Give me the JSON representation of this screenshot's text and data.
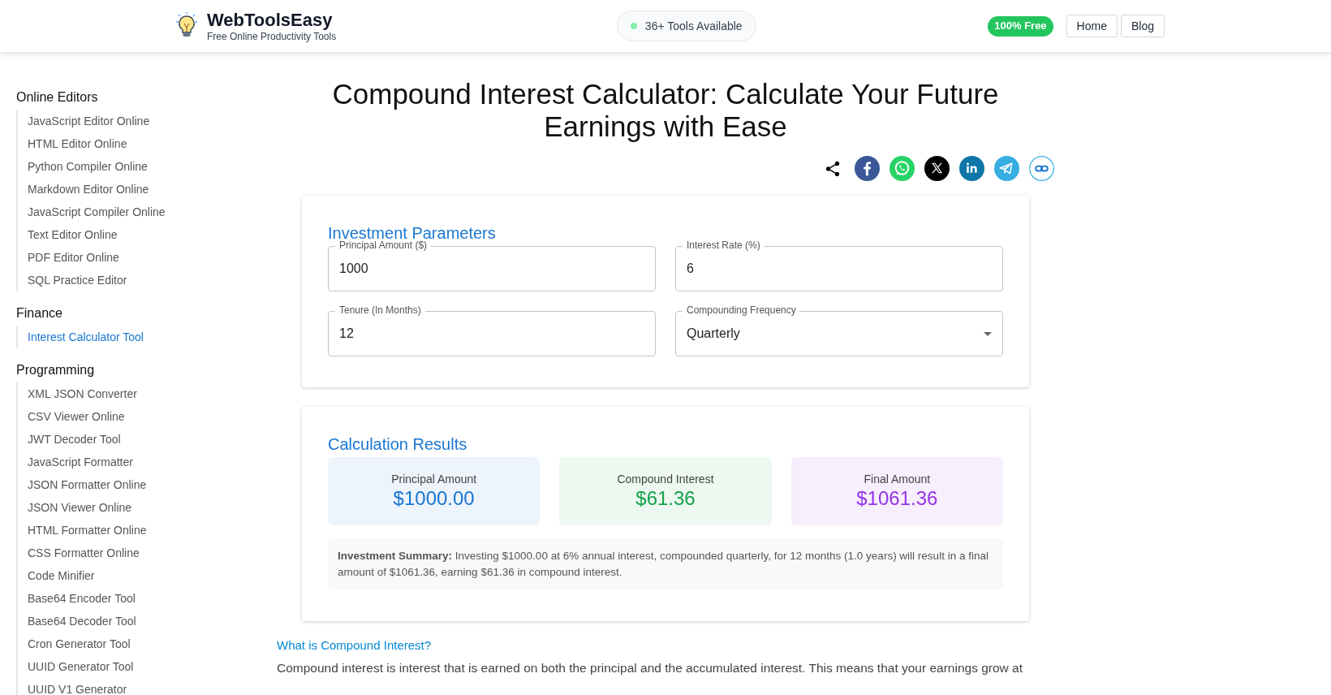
{
  "header": {
    "brand": "WebToolsEasy",
    "tagline": "Free Online Productivity Tools",
    "tools_pill": "36+ Tools Available",
    "free_badge": "100% Free",
    "nav": [
      "Home",
      "Blog"
    ]
  },
  "sidebar": [
    {
      "heading": "Online Editors",
      "items": [
        {
          "label": "JavaScript Editor Online",
          "selected": false
        },
        {
          "label": "HTML Editor Online",
          "selected": false
        },
        {
          "label": "Python Compiler Online",
          "selected": false
        },
        {
          "label": "Markdown Editor Online",
          "selected": false
        },
        {
          "label": "JavaScript Compiler Online",
          "selected": false
        },
        {
          "label": "Text Editor Online",
          "selected": false
        },
        {
          "label": "PDF Editor Online",
          "selected": false
        },
        {
          "label": "SQL Practice Editor",
          "selected": false
        }
      ]
    },
    {
      "heading": "Finance",
      "items": [
        {
          "label": "Interest Calculator Tool",
          "selected": true
        }
      ]
    },
    {
      "heading": "Programming",
      "items": [
        {
          "label": "XML JSON Converter",
          "selected": false
        },
        {
          "label": "CSV Viewer Online",
          "selected": false
        },
        {
          "label": "JWT Decoder Tool",
          "selected": false
        },
        {
          "label": "JavaScript Formatter",
          "selected": false
        },
        {
          "label": "JSON Formatter Online",
          "selected": false
        },
        {
          "label": "JSON Viewer Online",
          "selected": false
        },
        {
          "label": "HTML Formatter Online",
          "selected": false
        },
        {
          "label": "CSS Formatter Online",
          "selected": false
        },
        {
          "label": "Code Minifier",
          "selected": false
        },
        {
          "label": "Base64 Encoder Tool",
          "selected": false
        },
        {
          "label": "Base64 Decoder Tool",
          "selected": false
        },
        {
          "label": "Cron Generator Tool",
          "selected": false
        },
        {
          "label": "UUID Generator Tool",
          "selected": false
        },
        {
          "label": "UUID V1 Generator",
          "selected": false
        }
      ]
    }
  ],
  "title": "Compound Interest Calculator: Calculate Your Future Earnings with Ease",
  "parameters": {
    "heading": "Investment Parameters",
    "fields": [
      {
        "kind": "text",
        "label": "Principal Amount ($)",
        "value": "1000"
      },
      {
        "kind": "text",
        "label": "Interest Rate (%)",
        "value": "6"
      },
      {
        "kind": "text",
        "label": "Tenure (In Months)",
        "value": "12"
      },
      {
        "kind": "select",
        "label": "Compounding Frequency",
        "value": "Quarterly"
      }
    ]
  },
  "results": {
    "heading": "Calculation Results",
    "cards": [
      {
        "label": "Principal Amount",
        "value": "$1000.00",
        "color": "#1976d2"
      },
      {
        "label": "Compound Interest",
        "value": "$61.36",
        "color": "#16a34a"
      },
      {
        "label": "Final Amount",
        "value": "$1061.36",
        "color": "#9333ea"
      }
    ],
    "summary": "**Investment Summary:** Investing $1000.00 at 6% annual interest, compounded quarterly, for 12 months (1.0 years) will result in a final amount of $1061.36, earning $61.36 in compound interest."
  },
  "article": {
    "heading": "What is Compound Interest?",
    "paragraph": "Compound interest is interest that is earned on both the principal and the accumulated interest. This means that your earnings grow at"
  }
}
